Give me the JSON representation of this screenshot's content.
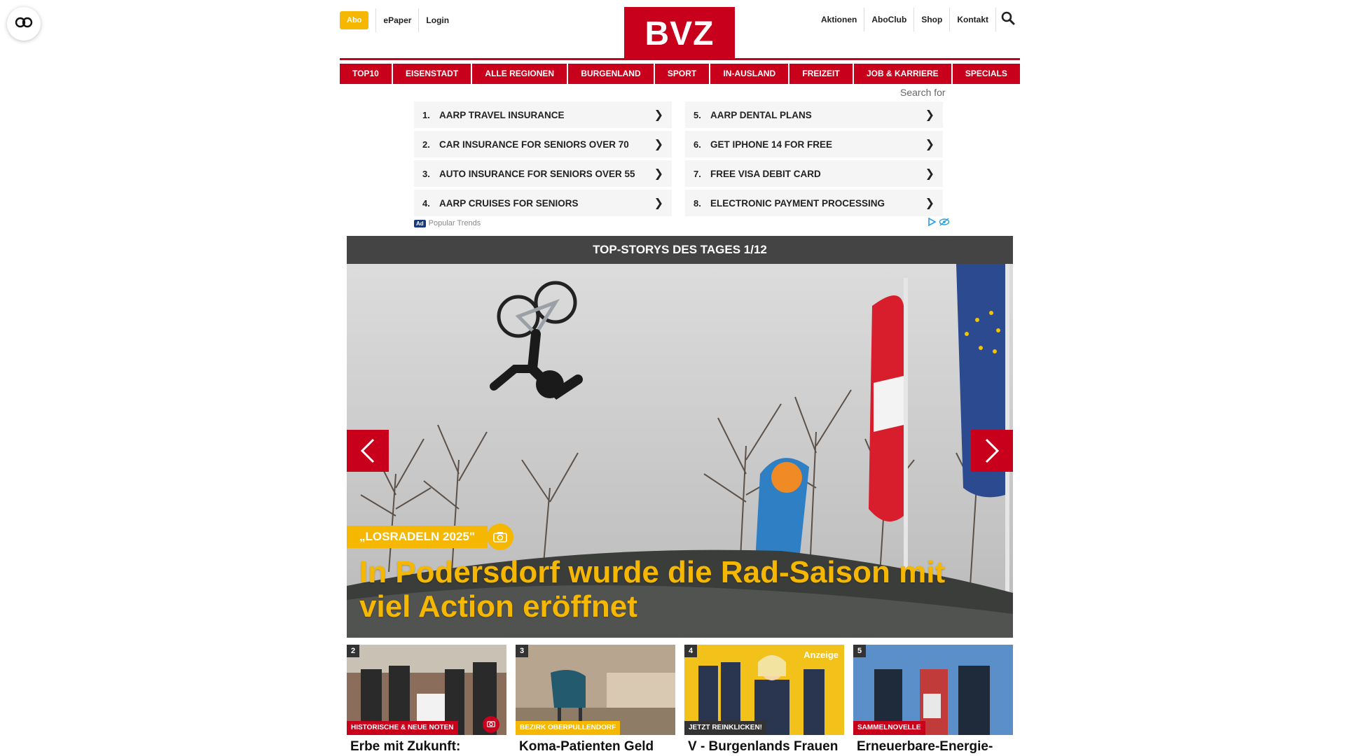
{
  "header": {
    "abo_label": "Abo",
    "left_links": [
      "ePaper",
      "Login"
    ],
    "logo_text": "BVZ",
    "right_links": [
      "Aktionen",
      "AboClub",
      "Shop",
      "Kontakt"
    ],
    "search_icon": "search-icon",
    "accent_color": "#c8001b",
    "abo_color": "#f5b700"
  },
  "nav": {
    "items": [
      "TOP10",
      "EISENSTADT",
      "ALLE REGIONEN",
      "BURGENLAND",
      "SPORT",
      "IN-AUSLAND",
      "FREIZEIT",
      "JOB & KARRIERE",
      "SPECIALS"
    ]
  },
  "ad": {
    "search_for": "Search for",
    "items": [
      {
        "num": "1.",
        "label": "AARP TRAVEL INSURANCE"
      },
      {
        "num": "5.",
        "label": "AARP DENTAL PLANS"
      },
      {
        "num": "2.",
        "label": "CAR INSURANCE FOR SENIORS OVER 70"
      },
      {
        "num": "6.",
        "label": "GET IPHONE 14 FOR FREE"
      },
      {
        "num": "3.",
        "label": "AUTO INSURANCE FOR SENIORS OVER 55"
      },
      {
        "num": "7.",
        "label": "FREE VISA DEBIT CARD"
      },
      {
        "num": "4.",
        "label": "AARP CRUISES FOR SENIORS"
      },
      {
        "num": "8.",
        "label": "ELECTRONIC PAYMENT PROCESSING"
      }
    ],
    "arrow": "❯",
    "tag": "Ad",
    "source": "Popular Trends"
  },
  "top_stories": {
    "bar_title": "TOP-STORYS DES TAGES 1/12",
    "hero": {
      "kicker": "„LOSRADELN 2025\"",
      "title": "In Podersdorf wurde die Rad-Saison mit viel Action eröffnet"
    },
    "cards": [
      {
        "num": "2",
        "category": "HISTORISCHE & NEUE NOTEN",
        "title": "Erbe mit Zukunft: Haydn-Hochschule",
        "cat_color": "red",
        "camera": true,
        "anzeige": ""
      },
      {
        "num": "3",
        "category": "BEZIRK OBERPULLENDORF",
        "title": "Koma-Patienten Geld weggenommen? Prozess",
        "cat_color": "yellow",
        "camera": false,
        "anzeige": ""
      },
      {
        "num": "4",
        "category": "JETZT REINKLICKEN!",
        "title": "V - Burgenlands Frauen - Hier geht's zum Channel!",
        "cat_color": "dark",
        "camera": false,
        "anzeige": "Anzeige"
      },
      {
        "num": "5",
        "category": "SAMMELNOVELLE",
        "title": "Erneuerbare-Energie-Ausbau im Burgenland",
        "cat_color": "red",
        "camera": false,
        "anzeige": ""
      }
    ]
  }
}
